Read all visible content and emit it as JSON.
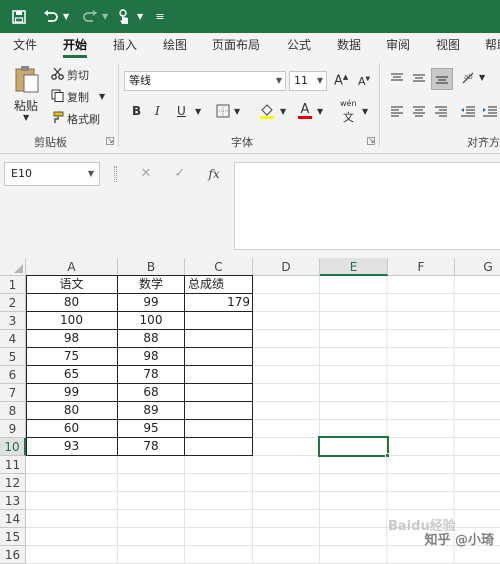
{
  "qat": {
    "save_icon": "save-icon",
    "undo_icon": "undo-icon",
    "redo_icon": "redo-icon",
    "touch_icon": "touch-mode-icon",
    "customize_icon": "customize-qat-icon"
  },
  "tabs": [
    "文件",
    "开始",
    "插入",
    "绘图",
    "页面布局",
    "公式",
    "数据",
    "审阅",
    "视图",
    "帮助"
  ],
  "active_tab": "开始",
  "clipboard": {
    "paste_label": "粘贴",
    "cut_label": "剪切",
    "copy_label": "复制",
    "format_painter_label": "格式刷",
    "group_label": "剪贴板"
  },
  "font": {
    "font_name": "等线",
    "font_size": "11",
    "grow_label": "A",
    "shrink_label": "A",
    "bold_label": "B",
    "italic_label": "I",
    "underline_label": "U",
    "font_color_label": "A",
    "phonetic_label": "wén",
    "phonetic_char": "文",
    "group_label": "字体"
  },
  "alignment": {
    "group_label": "对齐方"
  },
  "formula_bar": {
    "name_box": "E10",
    "cancel_icon": "cancel-icon",
    "enter_icon": "enter-icon",
    "fx_label": "fx",
    "formula": ""
  },
  "columns": [
    "A",
    "B",
    "C",
    "D",
    "E",
    "F",
    "G"
  ],
  "rows": [
    "1",
    "2",
    "3",
    "4",
    "5",
    "6",
    "7",
    "8",
    "9",
    "10",
    "11",
    "12",
    "13",
    "14",
    "15",
    "16"
  ],
  "selected_cell": "E10",
  "cells": {
    "headers": [
      "语文",
      "数学",
      "总成绩"
    ],
    "data": [
      [
        "80",
        "99",
        "179"
      ],
      [
        "100",
        "100",
        ""
      ],
      [
        "98",
        "88",
        ""
      ],
      [
        "75",
        "98",
        ""
      ],
      [
        "65",
        "78",
        ""
      ],
      [
        "99",
        "68",
        ""
      ],
      [
        "80",
        "89",
        ""
      ],
      [
        "60",
        "95",
        ""
      ],
      [
        "93",
        "78",
        ""
      ]
    ]
  },
  "watermark": {
    "text": "知乎 @小琦",
    "baidu": "Baidu经验"
  }
}
